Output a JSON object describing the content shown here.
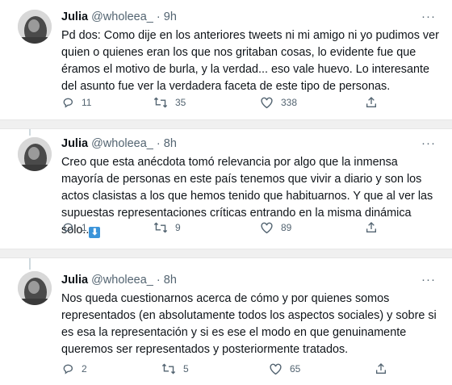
{
  "tweets": [
    {
      "name": "Julia",
      "handle": "@wholeea_",
      "time": "· 9h",
      "more": "···",
      "text": "Pd dos: Como dije en los anteriores tweets ni mi amigo ni yo pudimos ver quien o quienes eran los que nos gritaban cosas, lo evidente fue que éramos el motivo de burla, y la verdad... eso vale huevo. Lo interesante del asunto fue ver la verdadera faceta de este tipo de personas.",
      "replies": "11",
      "retweets": "35",
      "likes": "338"
    },
    {
      "name": "Julia",
      "handle": "@wholeea_",
      "time": "· 8h",
      "more": "···",
      "text": "Creo que esta anécdota tomó relevancia por algo que la inmensa mayoría de personas en este país tenemos que vivir a diario y son los actos clasistas a los que hemos tenido que habituarnos. Y que al ver las supuestas representaciones críticas entrando en la misma dinámica solo..",
      "emoji": "⬇",
      "replies": "1",
      "retweets": "9",
      "likes": "89"
    },
    {
      "name": "Julia",
      "handle": "@wholeea_",
      "time": "· 8h",
      "more": "···",
      "text": "Nos queda cuestionarnos acerca de cómo y por quienes somos representados (en absolutamente todos los aspectos sociales) y sobre si es esa la representación y si es ese el modo en que genuinamente queremos ser representados y posteriormente tratados.",
      "replies": "2",
      "retweets": "5",
      "likes": "65"
    }
  ],
  "icons": {
    "reply": "reply-icon",
    "retweet": "retweet-icon",
    "like": "heart-icon",
    "share": "share-icon"
  },
  "colors": {
    "text": "#0f1419",
    "secondary": "#536471",
    "separator": "#f0f0f0",
    "emoji_blue": "#3b94d9"
  }
}
